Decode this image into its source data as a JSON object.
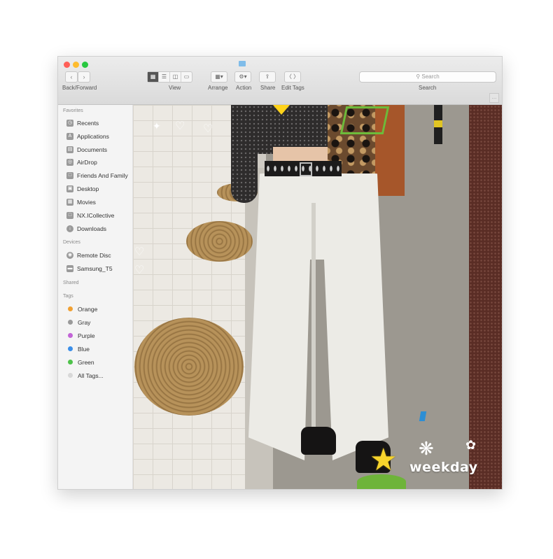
{
  "toolbar": {
    "back_label": "Back/Forward",
    "view_label": "View",
    "arrange_label": "Arrange",
    "action_label": "Action",
    "share_label": "Share",
    "edit_tags_label": "Edit Tags",
    "search_placeholder": "Search",
    "search_label": "Search"
  },
  "sidebar": {
    "favorites_title": "Favorites",
    "favorites": [
      {
        "label": "Recents",
        "icon": "clock-icon"
      },
      {
        "label": "Applications",
        "icon": "applications-icon"
      },
      {
        "label": "Documents",
        "icon": "documents-icon"
      },
      {
        "label": "AirDrop",
        "icon": "airdrop-icon"
      },
      {
        "label": "Friends And Family",
        "icon": "folder-icon"
      },
      {
        "label": "Desktop",
        "icon": "desktop-icon"
      },
      {
        "label": "Movies",
        "icon": "movies-icon"
      },
      {
        "label": "NX.ICollective",
        "icon": "folder-icon"
      },
      {
        "label": "Downloads",
        "icon": "downloads-icon"
      }
    ],
    "devices_title": "Devices",
    "devices": [
      {
        "label": "Remote Disc",
        "icon": "disc-icon"
      },
      {
        "label": "Samsung_T5",
        "icon": "drive-icon"
      }
    ],
    "shared_title": "Shared",
    "tags_title": "Tags",
    "tags": [
      {
        "label": "Orange",
        "color": "#f0a033"
      },
      {
        "label": "Gray",
        "color": "#9a9a9a"
      },
      {
        "label": "Purple",
        "color": "#c264d6"
      },
      {
        "label": "Blue",
        "color": "#3b8ee8"
      },
      {
        "label": "Green",
        "color": "#4ec24a"
      },
      {
        "label": "All Tags...",
        "color": "#d8d8d8"
      }
    ]
  },
  "content": {
    "watermark": "weekday"
  }
}
